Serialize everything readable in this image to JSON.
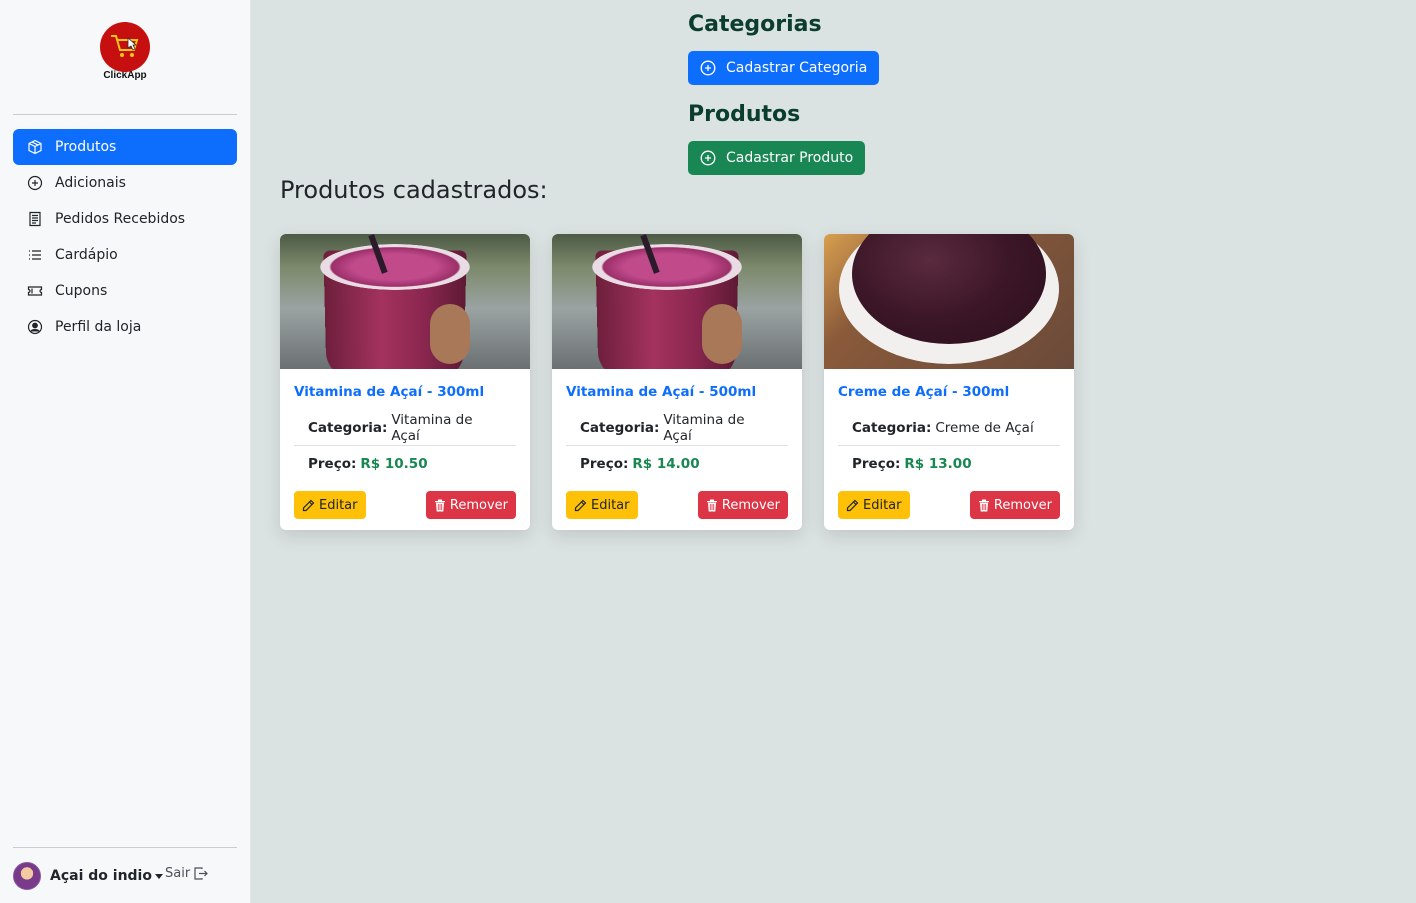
{
  "brand": {
    "name": "ClickApp"
  },
  "sidebar": {
    "items": [
      {
        "label": "Produtos",
        "icon": "box-icon",
        "active": true
      },
      {
        "label": "Adicionais",
        "icon": "plus-circle-icon"
      },
      {
        "label": "Pedidos Recebidos",
        "icon": "receipt-icon"
      },
      {
        "label": "Cardápio",
        "icon": "list-icon"
      },
      {
        "label": "Cupons",
        "icon": "ticket-icon"
      },
      {
        "label": "Perfil da loja",
        "icon": "person-circle-icon"
      }
    ],
    "user": {
      "name": "Açai do indio",
      "logout": "Sair"
    }
  },
  "main": {
    "categorias_title": "Categorias",
    "categorias_button": "Cadastrar Categoria",
    "produtos_title": "Produtos",
    "produtos_button": "Cadastrar Produto",
    "list_title": "Produtos cadastrados:"
  },
  "products": [
    {
      "name": "Vitamina de Açaí - 300ml",
      "category_label": "Categoria:",
      "category": "Vitamina de Açaí",
      "price_label": "Preço:",
      "price": "R$ 10.50",
      "edit": "Editar",
      "remove": "Remover"
    },
    {
      "name": "Vitamina de Açaí - 500ml",
      "category_label": "Categoria:",
      "category": "Vitamina de Açaí",
      "price_label": "Preço:",
      "price": "R$ 14.00",
      "edit": "Editar",
      "remove": "Remover"
    },
    {
      "name": "Creme de Açaí - 300ml",
      "category_label": "Categoria:",
      "category": "Creme de Açaí",
      "price_label": "Preço:",
      "price": "R$ 13.00",
      "edit": "Editar",
      "remove": "Remover"
    }
  ],
  "colors": {
    "primary": "#0d6efd",
    "success": "#198754",
    "warning": "#ffc107",
    "danger": "#dc3545",
    "heading": "#0b3d2e",
    "brand_red": "#c60f0f"
  }
}
